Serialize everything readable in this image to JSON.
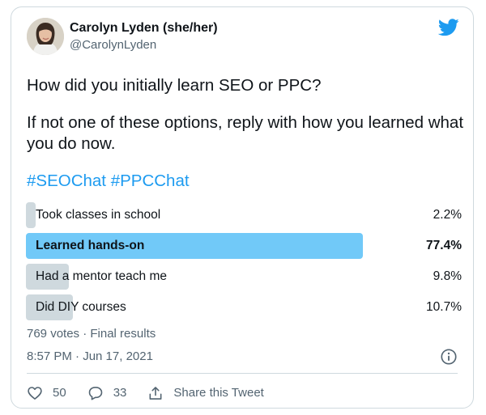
{
  "author": {
    "name": "Carolyn Lyden (she/her)",
    "handle": "@CarolynLyden"
  },
  "tweet": {
    "question": "How did you initially learn SEO or PPC?",
    "body": "If not one of these options, reply with how you learned what you do now.",
    "hashtags": [
      "#SEOChat",
      "#PPCChat"
    ]
  },
  "poll": {
    "options": [
      {
        "label": "Took classes in school",
        "percent": "2.2%",
        "share": 2.2
      },
      {
        "label": "Learned hands-on",
        "percent": "77.4%",
        "share": 77.4
      },
      {
        "label": "Had a mentor teach me",
        "percent": "9.8%",
        "share": 9.8
      },
      {
        "label": "Did DIY courses",
        "percent": "10.7%",
        "share": 10.7
      }
    ],
    "meta": "769 votes · Final results"
  },
  "timestamp": "8:57 PM · Jun 17, 2021",
  "actions": {
    "likes": "50",
    "replies": "33",
    "share_label": "Share this Tweet"
  },
  "colors": {
    "accent": "#1d9bf0",
    "winner_bar": "#71c9f8",
    "bar": "#cfd9de",
    "secondary_text": "#536471"
  },
  "icons": [
    "twitter-bird-icon",
    "info-icon",
    "heart-icon",
    "reply-icon",
    "share-icon"
  ]
}
